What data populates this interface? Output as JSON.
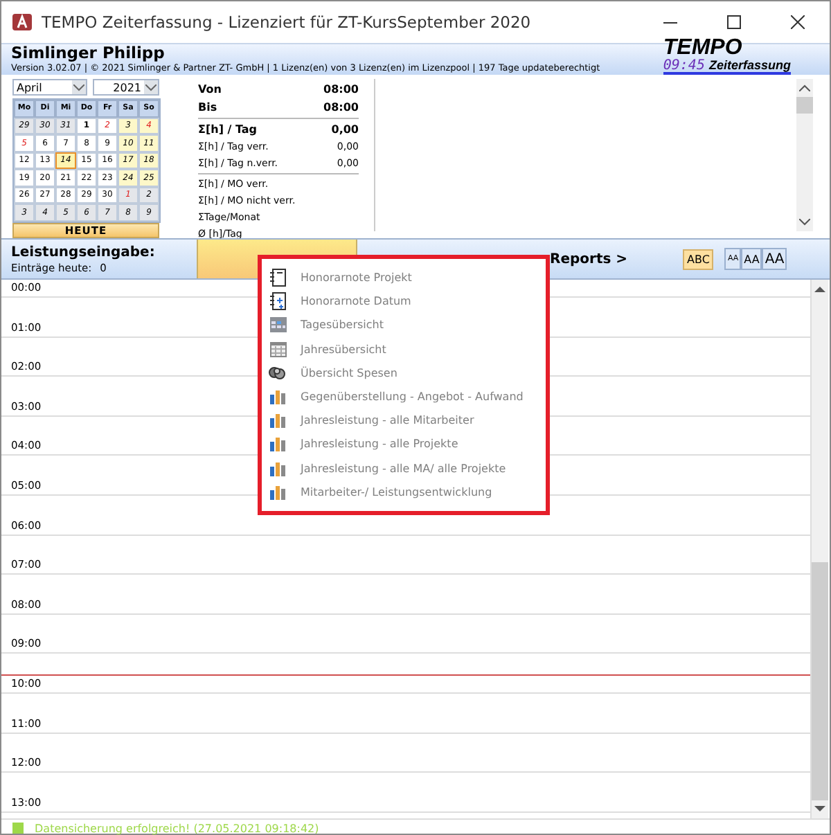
{
  "window": {
    "title": "TEMPO Zeiterfassung - Lizenziert für ZT-KursSeptember 2020"
  },
  "header": {
    "user": "Simlinger Philipp",
    "version_line": "Version 3.02.07 | © 2021 Simlinger & Partner ZT- GmbH | 1 Lizenz(en) von 3 Lizenz(en) im Lizenzpool | 197 Tage updateberechtigt",
    "logo_title": "TEMPO",
    "logo_time": "09:45",
    "logo_subtitle": "Zeiterfassung"
  },
  "calendar": {
    "month": "April",
    "year": "2021",
    "weekdays": [
      "Mo",
      "Di",
      "Mi",
      "Do",
      "Fr",
      "Sa",
      "So"
    ],
    "days": [
      {
        "day": "29",
        "kind": "other"
      },
      {
        "day": "30",
        "kind": "other"
      },
      {
        "day": "31",
        "kind": "other"
      },
      {
        "day": "1",
        "kind": "bold"
      },
      {
        "day": "2",
        "kind": "holiday"
      },
      {
        "day": "3",
        "kind": "weekend"
      },
      {
        "day": "4",
        "kind": "weekend-holiday"
      },
      {
        "day": "5",
        "kind": "holiday"
      },
      {
        "day": "6",
        "kind": "normal"
      },
      {
        "day": "7",
        "kind": "normal"
      },
      {
        "day": "8",
        "kind": "normal"
      },
      {
        "day": "9",
        "kind": "normal"
      },
      {
        "day": "10",
        "kind": "weekend"
      },
      {
        "day": "11",
        "kind": "weekend"
      },
      {
        "day": "12",
        "kind": "normal"
      },
      {
        "day": "13",
        "kind": "normal"
      },
      {
        "day": "14",
        "kind": "today"
      },
      {
        "day": "15",
        "kind": "normal"
      },
      {
        "day": "16",
        "kind": "normal"
      },
      {
        "day": "17",
        "kind": "weekend"
      },
      {
        "day": "18",
        "kind": "weekend"
      },
      {
        "day": "19",
        "kind": "normal"
      },
      {
        "day": "20",
        "kind": "normal"
      },
      {
        "day": "21",
        "kind": "normal"
      },
      {
        "day": "22",
        "kind": "normal"
      },
      {
        "day": "23",
        "kind": "normal"
      },
      {
        "day": "24",
        "kind": "weekend"
      },
      {
        "day": "25",
        "kind": "weekend"
      },
      {
        "day": "26",
        "kind": "normal"
      },
      {
        "day": "27",
        "kind": "normal"
      },
      {
        "day": "28",
        "kind": "normal"
      },
      {
        "day": "29",
        "kind": "normal"
      },
      {
        "day": "30",
        "kind": "normal"
      },
      {
        "day": "1",
        "kind": "other-holiday"
      },
      {
        "day": "2",
        "kind": "other"
      },
      {
        "day": "3",
        "kind": "other"
      },
      {
        "day": "4",
        "kind": "other"
      },
      {
        "day": "5",
        "kind": "other"
      },
      {
        "day": "6",
        "kind": "other"
      },
      {
        "day": "7",
        "kind": "other"
      },
      {
        "day": "8",
        "kind": "other"
      },
      {
        "day": "9",
        "kind": "other"
      }
    ],
    "today_button": "HEUTE"
  },
  "summary": [
    [
      {
        "label": "Von",
        "value": "08:00",
        "kind": "bold"
      },
      {
        "label": "Bis",
        "value": "08:00",
        "kind": "bold"
      }
    ],
    [
      {
        "label": "Σ[h] / Tag",
        "value": "0,00",
        "kind": "bold"
      },
      {
        "label": "Σ[h] / Tag verr.",
        "value": "0,00",
        "kind": "plain"
      },
      {
        "label": "Σ[h] / Tag n.verr.",
        "value": "0,00",
        "kind": "plain"
      }
    ],
    [
      {
        "label": "Σ[h] / MO verr.",
        "kind": "plain"
      },
      {
        "label": "Σ[h] / MO nicht verr.",
        "kind": "plain"
      },
      {
        "label": "ΣTage/Monat",
        "kind": "plain"
      },
      {
        "label": "Ø [h]/Tag",
        "kind": "plain"
      }
    ]
  ],
  "toolbar": {
    "title": "Leistungseingabe:",
    "entries_label": "Einträge heute:",
    "entries_count": "0",
    "reports": "Reports >",
    "spell_button": {
      "label": "ABC",
      "on": true
    },
    "font_sizes": [
      {
        "label": "AA",
        "kind": "small"
      },
      {
        "label": "AA",
        "kind": "medium"
      },
      {
        "label": "AA",
        "kind": "large"
      }
    ]
  },
  "timeline": [
    {
      "time": "00:00",
      "now": false
    },
    {
      "time": "01:00",
      "now": false
    },
    {
      "time": "02:00",
      "now": false
    },
    {
      "time": "03:00",
      "now": false
    },
    {
      "time": "04:00",
      "now": false
    },
    {
      "time": "05:00",
      "now": false
    },
    {
      "time": "06:00",
      "now": false
    },
    {
      "time": "07:00",
      "now": false
    },
    {
      "time": "08:00",
      "now": false
    },
    {
      "time": "09:00",
      "now": false
    },
    {
      "time": "10:00",
      "now": true
    },
    {
      "time": "11:00",
      "now": false
    },
    {
      "time": "12:00",
      "now": false
    },
    {
      "time": "13:00",
      "now": false
    }
  ],
  "reports_menu": [
    {
      "label": "Honorarnote Projekt",
      "kind": "note"
    },
    {
      "label": "Honorarnote Datum",
      "kind": "note-date"
    },
    {
      "label": "Tagesübersicht",
      "kind": "day"
    },
    {
      "label": "Jahresübersicht",
      "kind": "year"
    },
    {
      "label": "Übersicht Spesen",
      "kind": "money"
    },
    {
      "label": "Gegenüberstellung - Angebot - Aufwand",
      "kind": "chart"
    },
    {
      "label": "Jahresleistung - alle Mitarbeiter",
      "kind": "chart"
    },
    {
      "label": "Jahresleistung - alle Projekte",
      "kind": "chart"
    },
    {
      "label": "Jahresleistung - alle MA/ alle Projekte",
      "kind": "chart"
    },
    {
      "label": "Mitarbeiter-/ Leistungsentwicklung",
      "kind": "chart"
    }
  ],
  "status_bar": {
    "message": "Datensicherung erfolgreich! (27.05.2021 09:18:42)",
    "color": "#9ed84a"
  }
}
